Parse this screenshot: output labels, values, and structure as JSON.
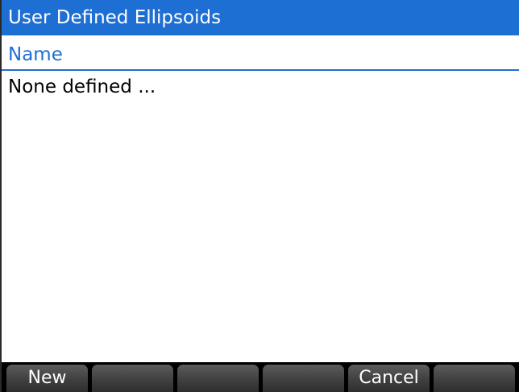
{
  "title": "User Defined Ellipsoids",
  "list": {
    "column_header": "Name",
    "empty_text": "None defined ..."
  },
  "menu": {
    "keys": [
      "New",
      "",
      "",
      "",
      "Cancel",
      ""
    ]
  },
  "colors": {
    "accent": "#1e6fd3",
    "background": "#ffffff",
    "menu_background": "#000000"
  }
}
